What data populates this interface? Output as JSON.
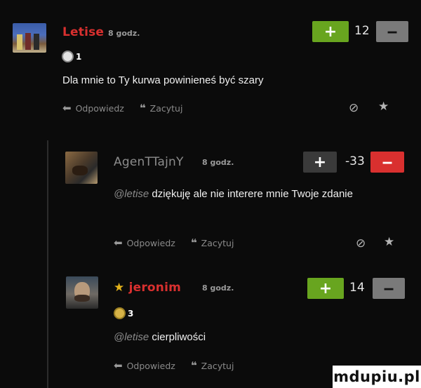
{
  "comments": [
    {
      "username": "Letise",
      "time": "8 godz.",
      "score": "12",
      "badge_count": "1",
      "text": "Dla mnie to Ty kurwa powinieneś być szary",
      "mention": "",
      "reply_label": "Odpowiedz",
      "quote_label": "Zacytuj",
      "badge_icon": "medal-icon"
    },
    {
      "username": "AgenTTajnY",
      "time": "8 godz.",
      "score": "-33",
      "mention": "@letise",
      "text": "dziękuję ale nie interere mnie Twoje zdanie",
      "reply_label": "Odpowiedz",
      "quote_label": "Zacytuj"
    },
    {
      "username": "jeronim",
      "time": "8 godz.",
      "score": "14",
      "badge_count": "3",
      "mention": "@letise",
      "text": "cierpliwości",
      "reply_label": "Odpowiedz",
      "quote_label": "Zacytuj",
      "badge_icon": "medal-icon"
    }
  ],
  "watermark": "mdupiu.pl",
  "colors": {
    "background": "#0b0b0b",
    "username_red": "#d9302f",
    "plus_green": "#68a51f",
    "minus_grey": "#7a7a7a"
  }
}
